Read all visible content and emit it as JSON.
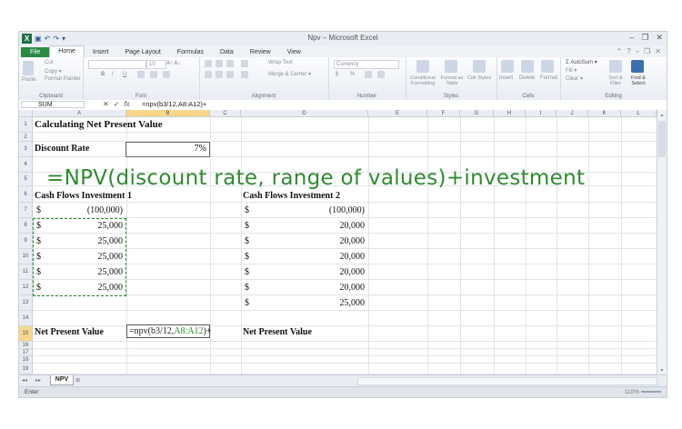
{
  "window": {
    "title": "Npv – Microsoft Excel"
  },
  "ribbon": {
    "tabs": [
      "File",
      "Home",
      "Insert",
      "Page Layout",
      "Formulas",
      "Data",
      "Review",
      "View"
    ],
    "clipboard": {
      "cut": "Cut",
      "copy": "Copy ▾",
      "format_painter": "Format Painter",
      "paste": "Paste",
      "label": "Clipboard"
    },
    "font": {
      "label": "Font",
      "size": "10",
      "bold": "B",
      "italic": "I",
      "underline": "U"
    },
    "alignment": {
      "label": "Alignment",
      "wrap": "Wrap Text",
      "merge": "Merge & Center ▾"
    },
    "number": {
      "label": "Number",
      "format": "Currency",
      "currency": "$",
      "percent": "%"
    },
    "styles": {
      "label": "Styles",
      "conditional": "Conditional Formatting",
      "as_table": "Format as Table",
      "cell_styles": "Cell Styles"
    },
    "cells": {
      "label": "Cells",
      "insert": "Insert",
      "delete": "Delete",
      "format": "Format"
    },
    "editing": {
      "label": "Editing",
      "autosum": "Σ AutoSum ▾",
      "fill": "Fill ▾",
      "clear": "Clear ▾",
      "sort": "Sort & Filter",
      "find": "Find & Select"
    }
  },
  "formula_bar": {
    "name": "SUM",
    "cancel": "✕",
    "enter": "✓",
    "fx": "fx",
    "formula": "=npv(b3/12,A8:A12)+"
  },
  "columns": [
    "A",
    "B",
    "C",
    "D",
    "E",
    "F",
    "G",
    "H",
    "I",
    "J",
    "K",
    "L"
  ],
  "rows": [
    "1",
    "2",
    "3",
    "4",
    "5",
    "6",
    "7",
    "8",
    "9",
    "10",
    "11",
    "12",
    "13",
    "14",
    "15",
    "16",
    "17",
    "18",
    "19"
  ],
  "sheet": {
    "title": "Calculating Net Present Value",
    "discount_label": "Discount Rate",
    "discount_value": "7%",
    "overlay": "=NPV(discount rate, range of values)+investment",
    "cf1_header": "Cash Flows Investment 1",
    "cf2_header": "Cash Flows Investment 2",
    "currency": "$",
    "cf1_values": [
      "(100,000)",
      "25,000",
      "25,000",
      "25,000",
      "25,000",
      "25,000"
    ],
    "cf2_values": [
      "(100,000)",
      "20,000",
      "20,000",
      "20,000",
      "20,000",
      "20,000",
      "25,000"
    ],
    "npv_label": "Net Present Value",
    "npv_label2": "Net Present Value",
    "edit": {
      "prefix": "=npv(b3/12,",
      "range": "A8:A12",
      "suffix": ")+"
    }
  },
  "sheet_tabs": {
    "active": "NPV"
  },
  "status": {
    "mode": "Enter",
    "zoom": "110%"
  }
}
